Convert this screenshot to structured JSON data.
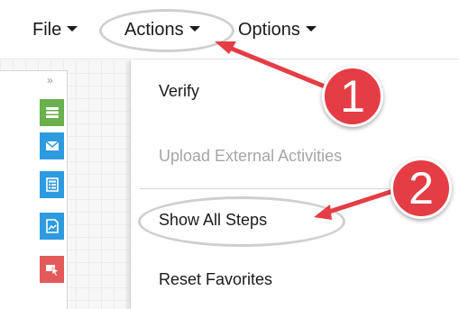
{
  "menubar": {
    "items": [
      {
        "label": "File"
      },
      {
        "label": "Actions"
      },
      {
        "label": "Options"
      }
    ]
  },
  "toolstrip": {
    "collapse_glyph": "»",
    "tools": [
      {
        "icon": "database-icon",
        "color": "#6ab04c"
      },
      {
        "icon": "envelope-icon",
        "color": "#2e9be0"
      },
      {
        "icon": "form-icon",
        "color": "#2e9be0"
      },
      {
        "icon": "image-document-icon",
        "color": "#2e9be0"
      },
      {
        "icon": "pointer-icon",
        "color": "#e35a5a"
      }
    ]
  },
  "actions_menu": {
    "items": [
      {
        "label": "Verify",
        "enabled": true
      },
      {
        "label": "Upload External Activities",
        "enabled": false
      },
      {
        "label": "Show All Steps",
        "enabled": true
      },
      {
        "label": "Reset Favorites",
        "enabled": true
      }
    ]
  },
  "annotations": {
    "badges": [
      {
        "label": "1"
      },
      {
        "label": "2"
      }
    ],
    "accent_color": "#e43d45"
  }
}
